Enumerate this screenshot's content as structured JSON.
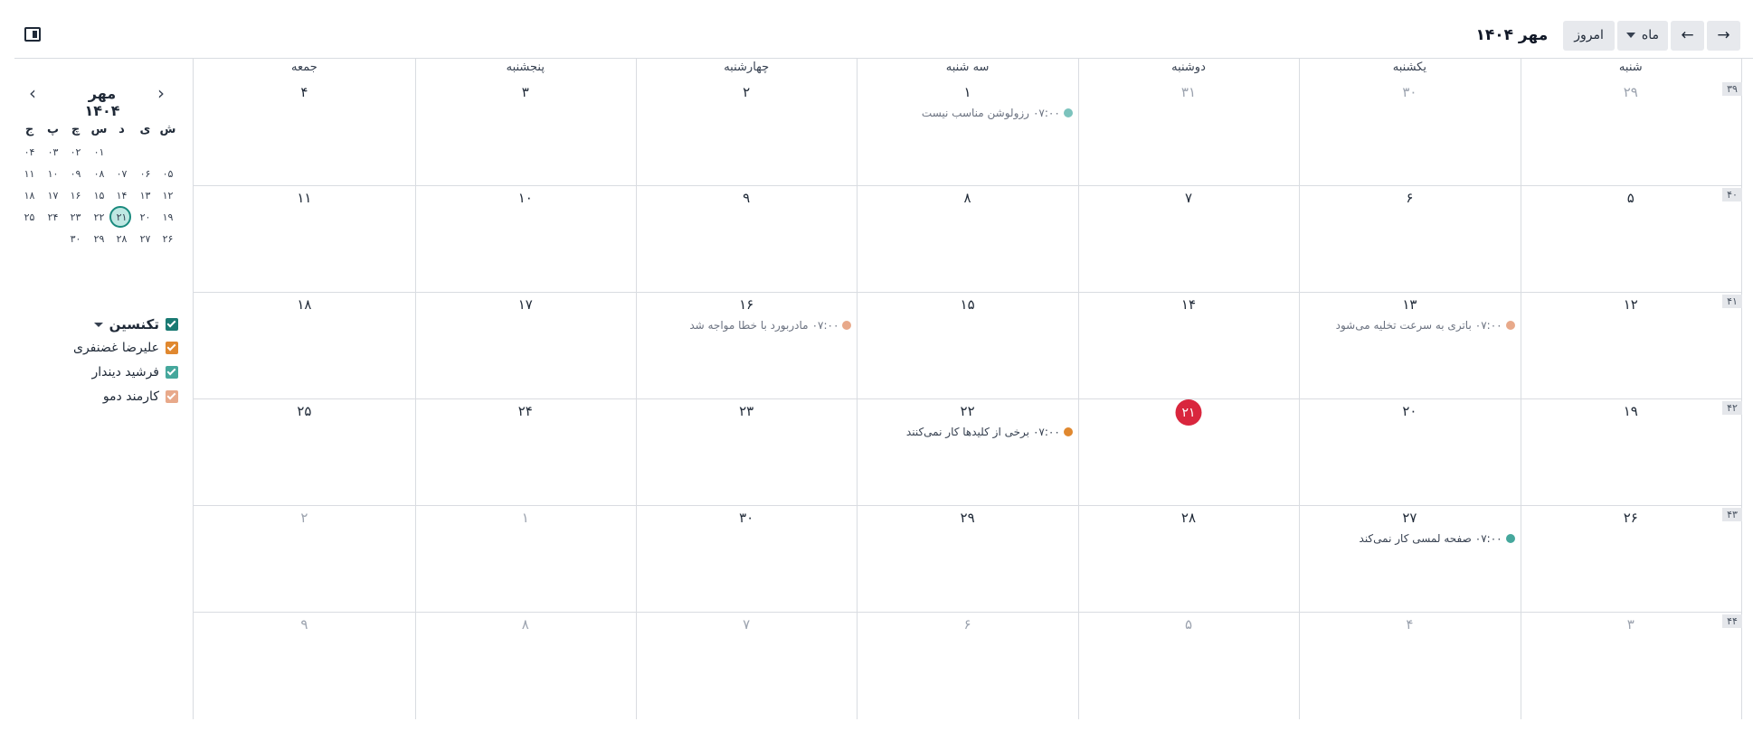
{
  "toolbar": {
    "next_icon": "→",
    "prev_icon": "←",
    "scale_label": "ماه",
    "today_label": "امروز",
    "period_label": "مهر ۱۴۰۴"
  },
  "weekdays": [
    "شنبه",
    "یکشنبه",
    "دوشنبه",
    "سه شنبه",
    "چهارشنبه",
    "پنجشنبه",
    "جمعه"
  ],
  "weeks": [
    {
      "num": "۳۹",
      "days": [
        {
          "d": "۲۹",
          "muted": true
        },
        {
          "d": "۳۰",
          "muted": true
        },
        {
          "d": "۳۱",
          "muted": true
        },
        {
          "d": "۱"
        },
        {
          "d": "۲"
        },
        {
          "d": "۳"
        },
        {
          "d": "۴"
        }
      ]
    },
    {
      "num": "۴۰",
      "days": [
        {
          "d": "۵"
        },
        {
          "d": "۶"
        },
        {
          "d": "۷"
        },
        {
          "d": "۸"
        },
        {
          "d": "۹"
        },
        {
          "d": "۱۰"
        },
        {
          "d": "۱۱"
        }
      ]
    },
    {
      "num": "۴۱",
      "days": [
        {
          "d": "۱۲"
        },
        {
          "d": "۱۳"
        },
        {
          "d": "۱۴"
        },
        {
          "d": "۱۵"
        },
        {
          "d": "۱۶"
        },
        {
          "d": "۱۷"
        },
        {
          "d": "۱۸"
        }
      ]
    },
    {
      "num": "۴۲",
      "days": [
        {
          "d": "۱۹"
        },
        {
          "d": "۲۰"
        },
        {
          "d": "۲۱",
          "today": true
        },
        {
          "d": "۲۲"
        },
        {
          "d": "۲۳"
        },
        {
          "d": "۲۴"
        },
        {
          "d": "۲۵"
        }
      ]
    },
    {
      "num": "۴۳",
      "days": [
        {
          "d": "۲۶"
        },
        {
          "d": "۲۷"
        },
        {
          "d": "۲۸"
        },
        {
          "d": "۲۹"
        },
        {
          "d": "۳۰"
        },
        {
          "d": "۱",
          "muted": true
        },
        {
          "d": "۲",
          "muted": true
        }
      ]
    },
    {
      "num": "۴۴",
      "days": [
        {
          "d": "۳",
          "muted": true
        },
        {
          "d": "۴",
          "muted": true
        },
        {
          "d": "۵",
          "muted": true
        },
        {
          "d": "۶",
          "muted": true
        },
        {
          "d": "۷",
          "muted": true
        },
        {
          "d": "۸",
          "muted": true
        },
        {
          "d": "۹",
          "muted": true
        }
      ]
    }
  ],
  "events": [
    {
      "week": 0,
      "day": 3,
      "time": "۰۷:۰۰",
      "title": "رزولوشن مناسب نیست",
      "color": "#7cc3bd",
      "past": true
    },
    {
      "week": 2,
      "day": 1,
      "time": "۰۷:۰۰",
      "title": "باتری به سرعت تخلیه می‌شود",
      "color": "#e8a98a",
      "past": true
    },
    {
      "week": 2,
      "day": 4,
      "time": "۰۷:۰۰",
      "title": "مادربورد با خطا مواجه شد",
      "color": "#e8a98a",
      "past": true
    },
    {
      "week": 3,
      "day": 3,
      "time": "۰۷:۰۰",
      "title": "برخی از کلیدها کار نمی‌کنند",
      "color": "#e0882f",
      "past": false
    },
    {
      "week": 4,
      "day": 1,
      "time": "۰۷:۰۰",
      "title": "صفحه لمسی کار نمی‌کند",
      "color": "#45a79c",
      "past": false
    }
  ],
  "mini_calendar": {
    "title": "مهر ۱۴۰۴",
    "prev_icon": "‹",
    "next_icon": "›",
    "headers": [
      "ش",
      "ی",
      "د",
      "س",
      "چ",
      "پ",
      "ج"
    ],
    "rows": [
      [
        "",
        "",
        "",
        "۰۱",
        "۰۲",
        "۰۳",
        "۰۴"
      ],
      [
        "۰۵",
        "۰۶",
        "۰۷",
        "۰۸",
        "۰۹",
        "۱۰",
        "۱۱"
      ],
      [
        "۱۲",
        "۱۳",
        "۱۴",
        "۱۵",
        "۱۶",
        "۱۷",
        "۱۸"
      ],
      [
        "۱۹",
        "۲۰",
        "۲۱",
        "۲۲",
        "۲۳",
        "۲۴",
        "۲۵"
      ],
      [
        "۲۶",
        "۲۷",
        "۲۸",
        "۲۹",
        "۳۰",
        "",
        ""
      ]
    ]
  },
  "filters": {
    "title": "تکنسین",
    "title_color": "#1a7a73",
    "items": [
      {
        "label": "علیرضا غضنفری",
        "color": "#e0882f"
      },
      {
        "label": "فرشید دیندار",
        "color": "#45a79c"
      },
      {
        "label": "کارمند دمو",
        "color": "#e8a98a"
      }
    ]
  }
}
